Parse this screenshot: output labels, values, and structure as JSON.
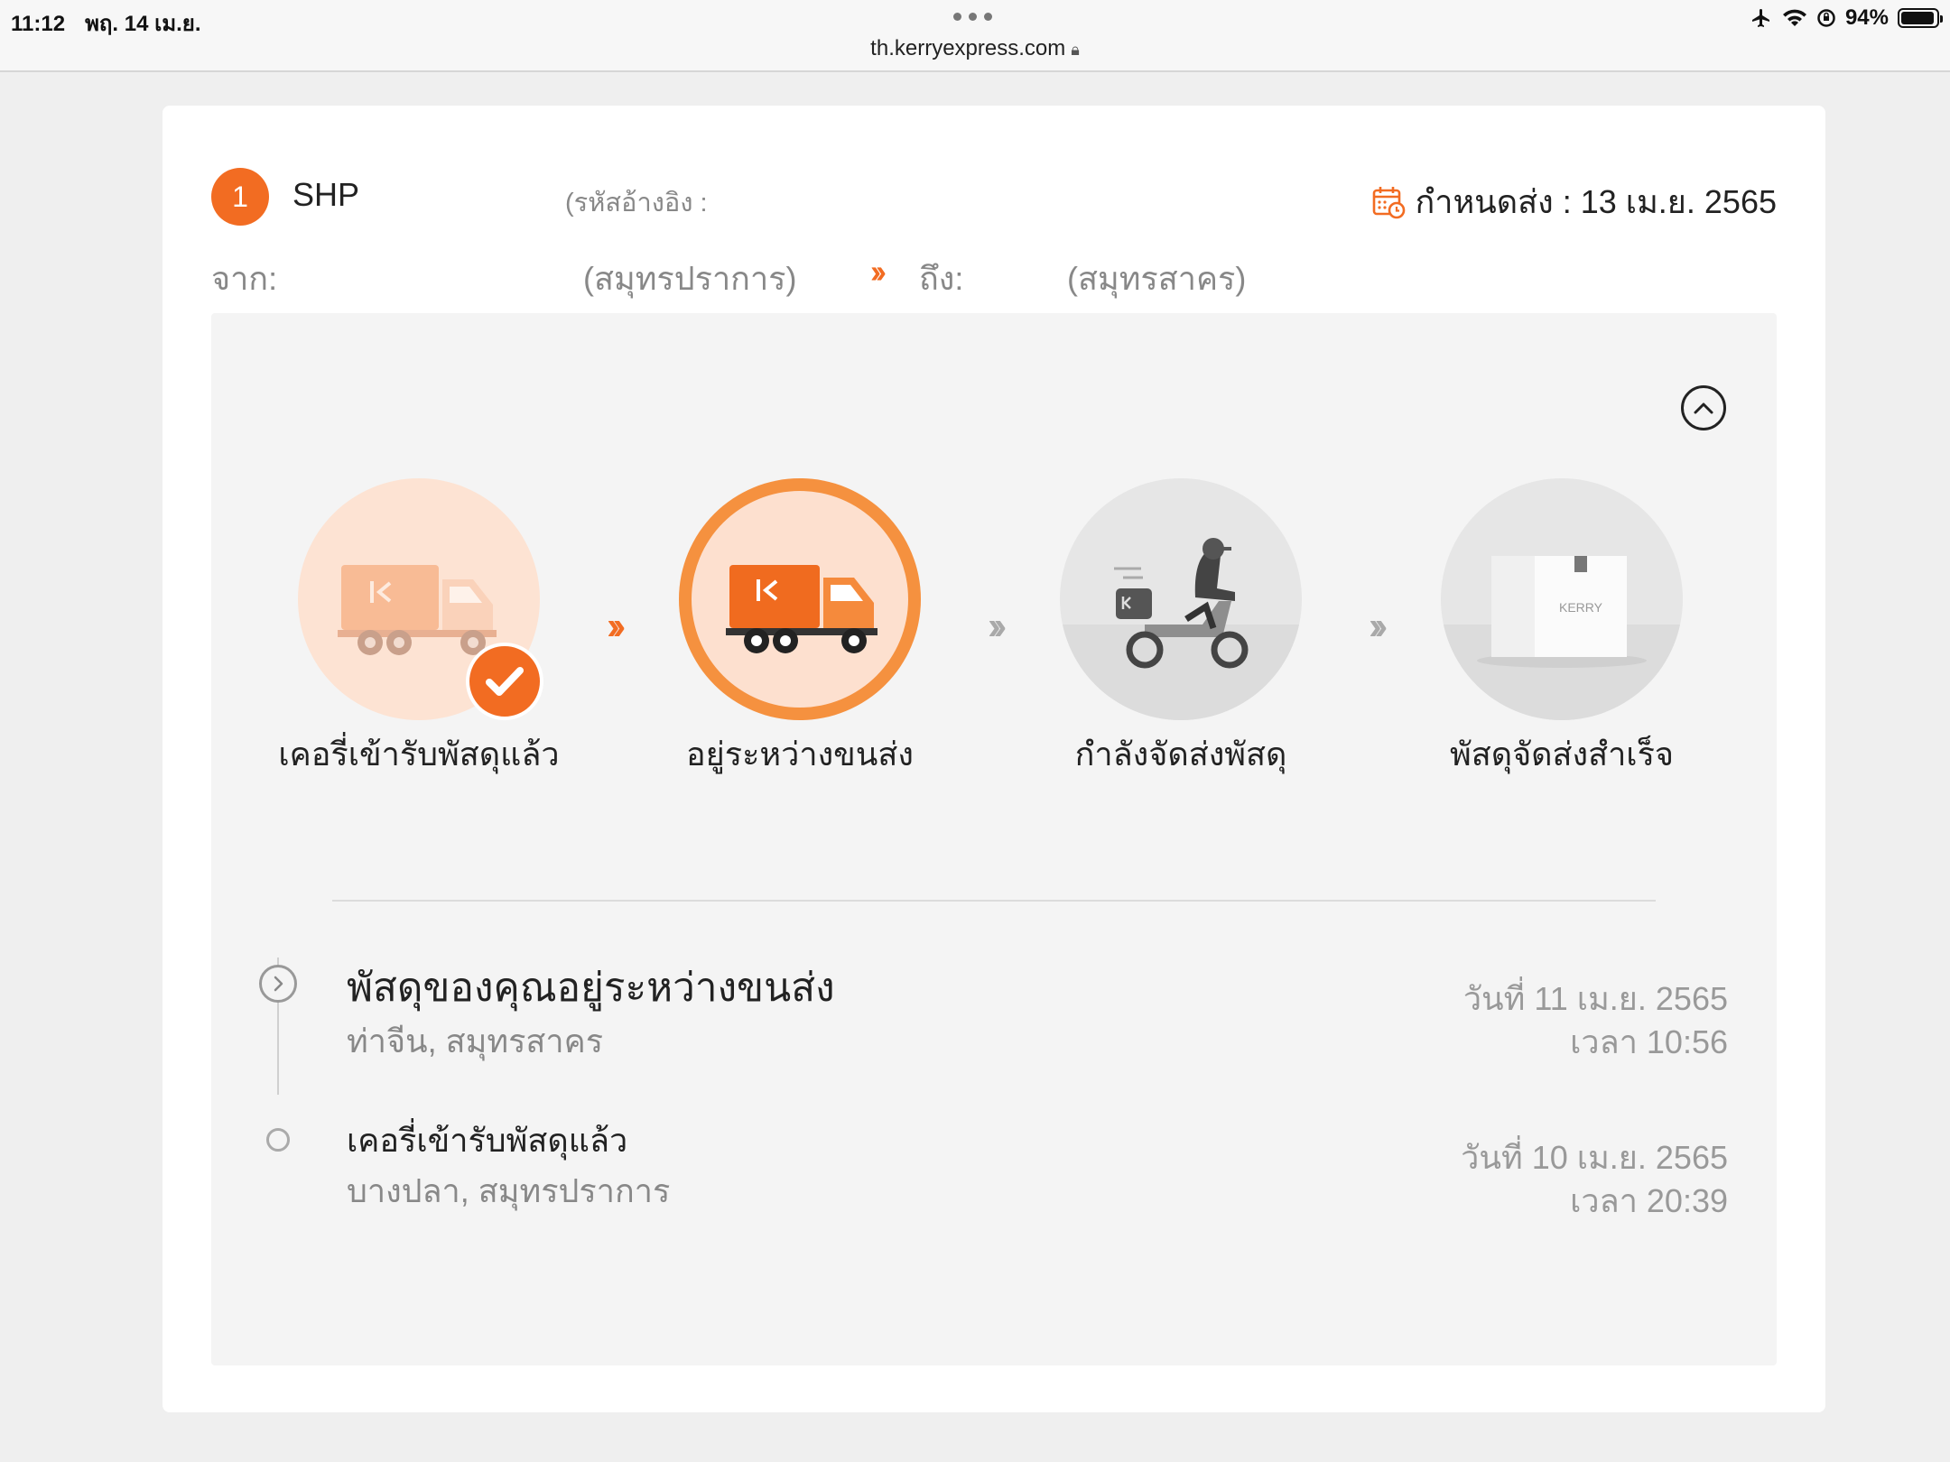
{
  "status_bar": {
    "time": "11:12",
    "date": "พฤ. 14 เม.ย.",
    "url": "th.kerryexpress.com",
    "battery": "94%",
    "battery_level": 0.94,
    "icons": [
      "airplane-icon",
      "wifi-icon",
      "orientation-lock-icon",
      "battery-icon"
    ]
  },
  "shipment": {
    "index": "1",
    "tracking_prefix": "SHP",
    "reference_label": "(รหัสอ้างอิง :",
    "due_label": "กำหนดส่ง : 13 เม.ย. 2565",
    "from_label": "จาก:",
    "from_province": "(สมุทรปราการ)",
    "to_label": "ถึง:",
    "to_province": "(สมุทรสาคร)"
  },
  "steps": [
    {
      "label": "เคอรี่เข้ารับพัสดุแล้ว",
      "state": "done",
      "icon": "truck-icon"
    },
    {
      "label": "อยู่ระหว่างขนส่ง",
      "state": "current",
      "icon": "truck-icon"
    },
    {
      "label": "กำลังจัดส่งพัสดุ",
      "state": "pending",
      "icon": "motorbike-courier-icon"
    },
    {
      "label": "พัสดุจัดส่งสำเร็จ",
      "state": "pending",
      "icon": "package-box-icon"
    }
  ],
  "box_brand": "KERRY",
  "events": [
    {
      "title": "พัสดุของคุณอยู่ระหว่างขนส่ง",
      "location": "ท่าจีน, สมุทรสาคร",
      "date": "วันที่ 11 เม.ย. 2565",
      "time": "เวลา 10:56"
    },
    {
      "title": "เคอรี่เข้ารับพัสดุแล้ว",
      "location": "บางปลา, สมุทรปราการ",
      "date": "วันที่ 10 เม.ย. 2565",
      "time": "เวลา 20:39"
    }
  ],
  "colors": {
    "accent": "#f26c22",
    "accent_light": "#fde0cf",
    "pending_grey": "#e6e6e6",
    "panel": "#f4f4f4"
  }
}
